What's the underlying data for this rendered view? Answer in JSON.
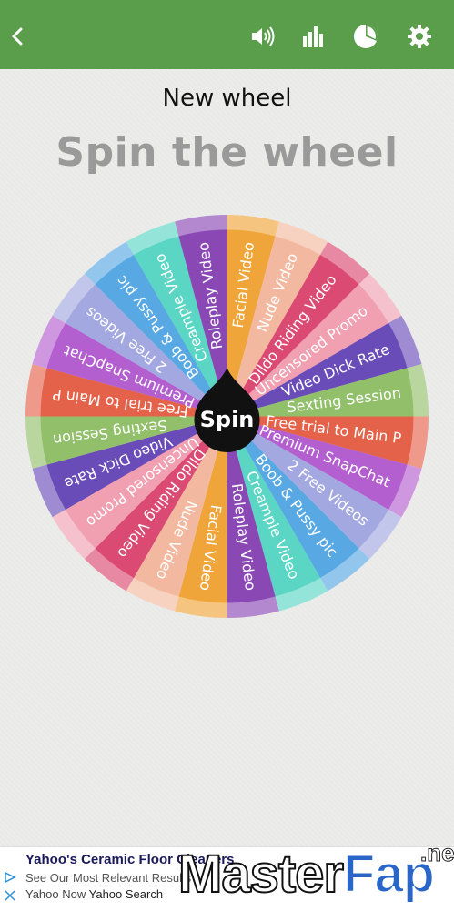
{
  "header": {
    "back_icon": "chevron-left-icon",
    "sound_icon": "volume-icon",
    "stats_icon": "bar-chart-icon",
    "pie_icon": "pie-chart-icon",
    "settings_icon": "gear-icon",
    "bg_color": "#5a9e4c"
  },
  "title": "New wheel",
  "subtitle": "Spin the wheel",
  "wheel": {
    "center_label": "Spin",
    "segments": [
      {
        "label": "Facial Video",
        "color": "#f0a53a"
      },
      {
        "label": "Nude Video",
        "color": "#f3b9a0"
      },
      {
        "label": "Dildo Riding Video",
        "color": "#db4a72"
      },
      {
        "label": "Uncensored Promo",
        "color": "#f0a0b0"
      },
      {
        "label": "Video Dick Rate",
        "color": "#6a4cb8"
      },
      {
        "label": "Sexting Session",
        "color": "#92c06a"
      },
      {
        "label": "Free trial to Main P",
        "color": "#e5624a"
      },
      {
        "label": "Premium SnapChat",
        "color": "#b35fcf"
      },
      {
        "label": "2 Free Videos",
        "color": "#a3a8e0"
      },
      {
        "label": "Boob & Pussy pic",
        "color": "#57a8e3"
      },
      {
        "label": "Creampie Video",
        "color": "#5bd6c4"
      },
      {
        "label": "Roleplay Video",
        "color": "#8a48b5"
      }
    ]
  },
  "ad": {
    "title": "Yahoo's Ceramic Floor Cleaners",
    "description": "See Our Most Relevant Results",
    "source_prefix": "Yahoo Now",
    "source_name": "Yahoo Search",
    "play_icon": "ad-choices-icon",
    "close_icon": "close-icon"
  },
  "watermark": {
    "part1": "Master",
    "part2": "Fap",
    "suffix": ".net"
  }
}
